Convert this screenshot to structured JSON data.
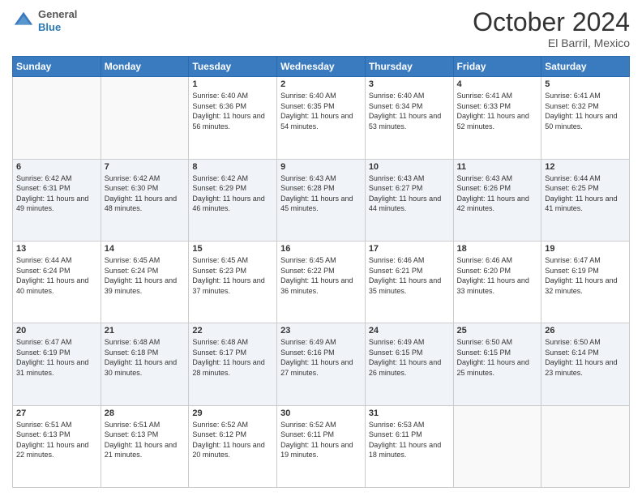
{
  "header": {
    "logo_line1": "General",
    "logo_line2": "Blue",
    "title": "October 2024",
    "subtitle": "El Barril, Mexico"
  },
  "weekdays": [
    "Sunday",
    "Monday",
    "Tuesday",
    "Wednesday",
    "Thursday",
    "Friday",
    "Saturday"
  ],
  "weeks": [
    [
      {
        "day": "",
        "sunrise": "",
        "sunset": "",
        "daylight": ""
      },
      {
        "day": "",
        "sunrise": "",
        "sunset": "",
        "daylight": ""
      },
      {
        "day": "1",
        "sunrise": "Sunrise: 6:40 AM",
        "sunset": "Sunset: 6:36 PM",
        "daylight": "Daylight: 11 hours and 56 minutes."
      },
      {
        "day": "2",
        "sunrise": "Sunrise: 6:40 AM",
        "sunset": "Sunset: 6:35 PM",
        "daylight": "Daylight: 11 hours and 54 minutes."
      },
      {
        "day": "3",
        "sunrise": "Sunrise: 6:40 AM",
        "sunset": "Sunset: 6:34 PM",
        "daylight": "Daylight: 11 hours and 53 minutes."
      },
      {
        "day": "4",
        "sunrise": "Sunrise: 6:41 AM",
        "sunset": "Sunset: 6:33 PM",
        "daylight": "Daylight: 11 hours and 52 minutes."
      },
      {
        "day": "5",
        "sunrise": "Sunrise: 6:41 AM",
        "sunset": "Sunset: 6:32 PM",
        "daylight": "Daylight: 11 hours and 50 minutes."
      }
    ],
    [
      {
        "day": "6",
        "sunrise": "Sunrise: 6:42 AM",
        "sunset": "Sunset: 6:31 PM",
        "daylight": "Daylight: 11 hours and 49 minutes."
      },
      {
        "day": "7",
        "sunrise": "Sunrise: 6:42 AM",
        "sunset": "Sunset: 6:30 PM",
        "daylight": "Daylight: 11 hours and 48 minutes."
      },
      {
        "day": "8",
        "sunrise": "Sunrise: 6:42 AM",
        "sunset": "Sunset: 6:29 PM",
        "daylight": "Daylight: 11 hours and 46 minutes."
      },
      {
        "day": "9",
        "sunrise": "Sunrise: 6:43 AM",
        "sunset": "Sunset: 6:28 PM",
        "daylight": "Daylight: 11 hours and 45 minutes."
      },
      {
        "day": "10",
        "sunrise": "Sunrise: 6:43 AM",
        "sunset": "Sunset: 6:27 PM",
        "daylight": "Daylight: 11 hours and 44 minutes."
      },
      {
        "day": "11",
        "sunrise": "Sunrise: 6:43 AM",
        "sunset": "Sunset: 6:26 PM",
        "daylight": "Daylight: 11 hours and 42 minutes."
      },
      {
        "day": "12",
        "sunrise": "Sunrise: 6:44 AM",
        "sunset": "Sunset: 6:25 PM",
        "daylight": "Daylight: 11 hours and 41 minutes."
      }
    ],
    [
      {
        "day": "13",
        "sunrise": "Sunrise: 6:44 AM",
        "sunset": "Sunset: 6:24 PM",
        "daylight": "Daylight: 11 hours and 40 minutes."
      },
      {
        "day": "14",
        "sunrise": "Sunrise: 6:45 AM",
        "sunset": "Sunset: 6:24 PM",
        "daylight": "Daylight: 11 hours and 39 minutes."
      },
      {
        "day": "15",
        "sunrise": "Sunrise: 6:45 AM",
        "sunset": "Sunset: 6:23 PM",
        "daylight": "Daylight: 11 hours and 37 minutes."
      },
      {
        "day": "16",
        "sunrise": "Sunrise: 6:45 AM",
        "sunset": "Sunset: 6:22 PM",
        "daylight": "Daylight: 11 hours and 36 minutes."
      },
      {
        "day": "17",
        "sunrise": "Sunrise: 6:46 AM",
        "sunset": "Sunset: 6:21 PM",
        "daylight": "Daylight: 11 hours and 35 minutes."
      },
      {
        "day": "18",
        "sunrise": "Sunrise: 6:46 AM",
        "sunset": "Sunset: 6:20 PM",
        "daylight": "Daylight: 11 hours and 33 minutes."
      },
      {
        "day": "19",
        "sunrise": "Sunrise: 6:47 AM",
        "sunset": "Sunset: 6:19 PM",
        "daylight": "Daylight: 11 hours and 32 minutes."
      }
    ],
    [
      {
        "day": "20",
        "sunrise": "Sunrise: 6:47 AM",
        "sunset": "Sunset: 6:19 PM",
        "daylight": "Daylight: 11 hours and 31 minutes."
      },
      {
        "day": "21",
        "sunrise": "Sunrise: 6:48 AM",
        "sunset": "Sunset: 6:18 PM",
        "daylight": "Daylight: 11 hours and 30 minutes."
      },
      {
        "day": "22",
        "sunrise": "Sunrise: 6:48 AM",
        "sunset": "Sunset: 6:17 PM",
        "daylight": "Daylight: 11 hours and 28 minutes."
      },
      {
        "day": "23",
        "sunrise": "Sunrise: 6:49 AM",
        "sunset": "Sunset: 6:16 PM",
        "daylight": "Daylight: 11 hours and 27 minutes."
      },
      {
        "day": "24",
        "sunrise": "Sunrise: 6:49 AM",
        "sunset": "Sunset: 6:15 PM",
        "daylight": "Daylight: 11 hours and 26 minutes."
      },
      {
        "day": "25",
        "sunrise": "Sunrise: 6:50 AM",
        "sunset": "Sunset: 6:15 PM",
        "daylight": "Daylight: 11 hours and 25 minutes."
      },
      {
        "day": "26",
        "sunrise": "Sunrise: 6:50 AM",
        "sunset": "Sunset: 6:14 PM",
        "daylight": "Daylight: 11 hours and 23 minutes."
      }
    ],
    [
      {
        "day": "27",
        "sunrise": "Sunrise: 6:51 AM",
        "sunset": "Sunset: 6:13 PM",
        "daylight": "Daylight: 11 hours and 22 minutes."
      },
      {
        "day": "28",
        "sunrise": "Sunrise: 6:51 AM",
        "sunset": "Sunset: 6:13 PM",
        "daylight": "Daylight: 11 hours and 21 minutes."
      },
      {
        "day": "29",
        "sunrise": "Sunrise: 6:52 AM",
        "sunset": "Sunset: 6:12 PM",
        "daylight": "Daylight: 11 hours and 20 minutes."
      },
      {
        "day": "30",
        "sunrise": "Sunrise: 6:52 AM",
        "sunset": "Sunset: 6:11 PM",
        "daylight": "Daylight: 11 hours and 19 minutes."
      },
      {
        "day": "31",
        "sunrise": "Sunrise: 6:53 AM",
        "sunset": "Sunset: 6:11 PM",
        "daylight": "Daylight: 11 hours and 18 minutes."
      },
      {
        "day": "",
        "sunrise": "",
        "sunset": "",
        "daylight": ""
      },
      {
        "day": "",
        "sunrise": "",
        "sunset": "",
        "daylight": ""
      }
    ]
  ]
}
